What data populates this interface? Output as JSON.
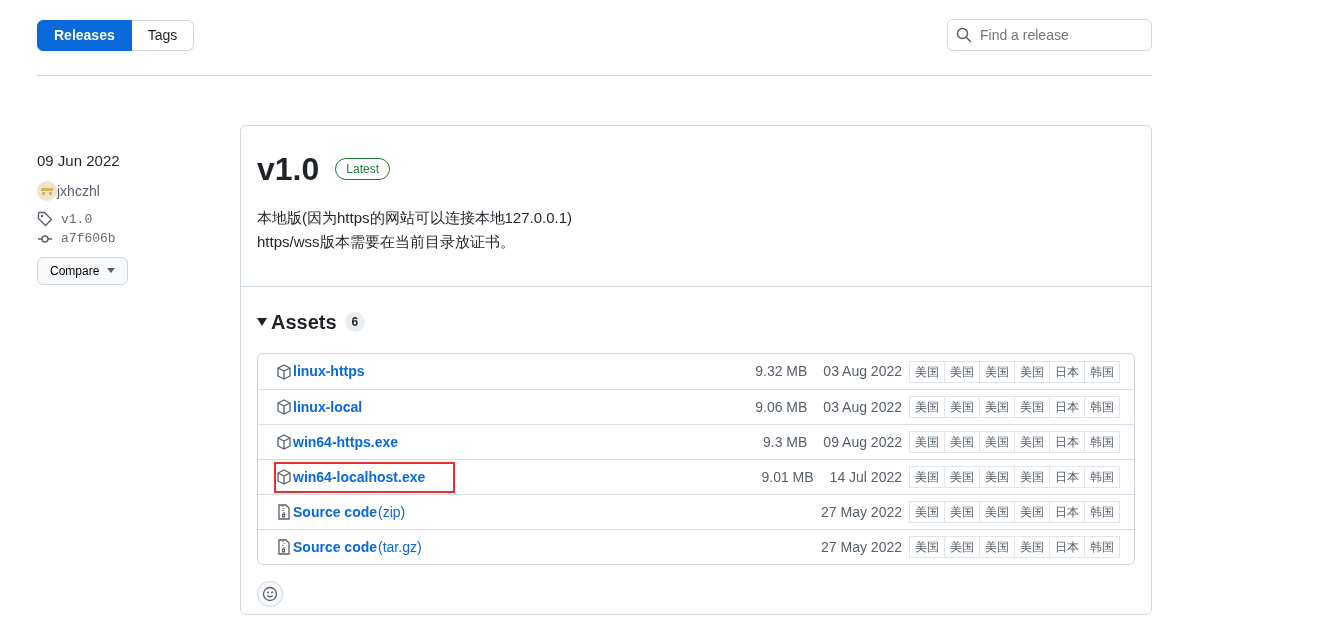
{
  "tabs": [
    {
      "label": "Releases",
      "selected": true
    },
    {
      "label": "Tags",
      "selected": false
    }
  ],
  "search": {
    "placeholder": "Find a release"
  },
  "release": {
    "date": "09 Jun 2022",
    "author": "jxhczhl",
    "tag": "v1.0",
    "commit": "a7f606b",
    "compare_button": "Compare",
    "title": "v1.0",
    "badge": "Latest",
    "description": [
      "本地版(因为https的网站可以连接本地127.0.0.1)",
      "https/wss版本需要在当前目录放证书。"
    ],
    "assets_heading": "Assets",
    "assets_expanded": true,
    "assets_count": "6",
    "assets": [
      {
        "kind": "package",
        "name": "linux-https",
        "size": "9.32 MB",
        "date": "03 Aug 2022",
        "highlighted": false,
        "mirrors": [
          "美国",
          "美国",
          "美国",
          "美国",
          "日本",
          "韩国"
        ]
      },
      {
        "kind": "package",
        "name": "linux-local",
        "size": "9.06 MB",
        "date": "03 Aug 2022",
        "highlighted": false,
        "mirrors": [
          "美国",
          "美国",
          "美国",
          "美国",
          "日本",
          "韩国"
        ]
      },
      {
        "kind": "package",
        "name": "win64-https.exe",
        "size": "9.3 MB",
        "date": "09 Aug 2022",
        "highlighted": false,
        "mirrors": [
          "美国",
          "美国",
          "美国",
          "美国",
          "日本",
          "韩国"
        ]
      },
      {
        "kind": "package",
        "name": "win64-localhost.exe",
        "size": "9.01 MB",
        "date": "14 Jul 2022",
        "highlighted": true,
        "mirrors": [
          "美国",
          "美国",
          "美国",
          "美国",
          "日本",
          "韩国"
        ]
      },
      {
        "kind": "source",
        "name": "Source code",
        "suffix": "(zip)",
        "date": "27 May 2022",
        "highlighted": false,
        "mirrors": [
          "美国",
          "美国",
          "美国",
          "美国",
          "日本",
          "韩国"
        ]
      },
      {
        "kind": "source",
        "name": "Source code",
        "suffix": "(tar.gz)",
        "date": "27 May 2022",
        "highlighted": false,
        "mirrors": [
          "美国",
          "美国",
          "美国",
          "美国",
          "日本",
          "韩国"
        ]
      }
    ]
  }
}
